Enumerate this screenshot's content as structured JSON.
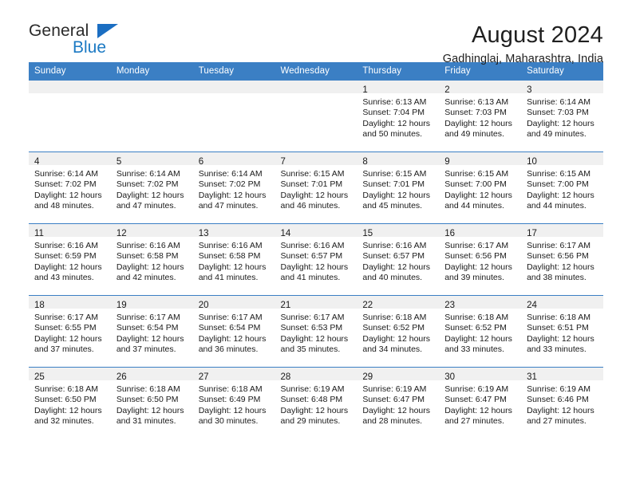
{
  "brand": {
    "name_top": "General",
    "name_bottom": "Blue",
    "flag_icon": "triangle-flag-icon",
    "accent_color": "#1b6ec2"
  },
  "header": {
    "title": "August 2024",
    "subtitle": "Gadhinglaj, Maharashtra, India"
  },
  "calendar": {
    "header_bg": "#3b7fc4",
    "daynum_bg": "#f0f0f0",
    "weekday_headers": [
      "Sunday",
      "Monday",
      "Tuesday",
      "Wednesday",
      "Thursday",
      "Friday",
      "Saturday"
    ],
    "weeks": [
      [
        {
          "day": "",
          "lines": []
        },
        {
          "day": "",
          "lines": []
        },
        {
          "day": "",
          "lines": []
        },
        {
          "day": "",
          "lines": []
        },
        {
          "day": "1",
          "lines": [
            "Sunrise: 6:13 AM",
            "Sunset: 7:04 PM",
            "Daylight: 12 hours",
            "and 50 minutes."
          ]
        },
        {
          "day": "2",
          "lines": [
            "Sunrise: 6:13 AM",
            "Sunset: 7:03 PM",
            "Daylight: 12 hours",
            "and 49 minutes."
          ]
        },
        {
          "day": "3",
          "lines": [
            "Sunrise: 6:14 AM",
            "Sunset: 7:03 PM",
            "Daylight: 12 hours",
            "and 49 minutes."
          ]
        }
      ],
      [
        {
          "day": "4",
          "lines": [
            "Sunrise: 6:14 AM",
            "Sunset: 7:02 PM",
            "Daylight: 12 hours",
            "and 48 minutes."
          ]
        },
        {
          "day": "5",
          "lines": [
            "Sunrise: 6:14 AM",
            "Sunset: 7:02 PM",
            "Daylight: 12 hours",
            "and 47 minutes."
          ]
        },
        {
          "day": "6",
          "lines": [
            "Sunrise: 6:14 AM",
            "Sunset: 7:02 PM",
            "Daylight: 12 hours",
            "and 47 minutes."
          ]
        },
        {
          "day": "7",
          "lines": [
            "Sunrise: 6:15 AM",
            "Sunset: 7:01 PM",
            "Daylight: 12 hours",
            "and 46 minutes."
          ]
        },
        {
          "day": "8",
          "lines": [
            "Sunrise: 6:15 AM",
            "Sunset: 7:01 PM",
            "Daylight: 12 hours",
            "and 45 minutes."
          ]
        },
        {
          "day": "9",
          "lines": [
            "Sunrise: 6:15 AM",
            "Sunset: 7:00 PM",
            "Daylight: 12 hours",
            "and 44 minutes."
          ]
        },
        {
          "day": "10",
          "lines": [
            "Sunrise: 6:15 AM",
            "Sunset: 7:00 PM",
            "Daylight: 12 hours",
            "and 44 minutes."
          ]
        }
      ],
      [
        {
          "day": "11",
          "lines": [
            "Sunrise: 6:16 AM",
            "Sunset: 6:59 PM",
            "Daylight: 12 hours",
            "and 43 minutes."
          ]
        },
        {
          "day": "12",
          "lines": [
            "Sunrise: 6:16 AM",
            "Sunset: 6:58 PM",
            "Daylight: 12 hours",
            "and 42 minutes."
          ]
        },
        {
          "day": "13",
          "lines": [
            "Sunrise: 6:16 AM",
            "Sunset: 6:58 PM",
            "Daylight: 12 hours",
            "and 41 minutes."
          ]
        },
        {
          "day": "14",
          "lines": [
            "Sunrise: 6:16 AM",
            "Sunset: 6:57 PM",
            "Daylight: 12 hours",
            "and 41 minutes."
          ]
        },
        {
          "day": "15",
          "lines": [
            "Sunrise: 6:16 AM",
            "Sunset: 6:57 PM",
            "Daylight: 12 hours",
            "and 40 minutes."
          ]
        },
        {
          "day": "16",
          "lines": [
            "Sunrise: 6:17 AM",
            "Sunset: 6:56 PM",
            "Daylight: 12 hours",
            "and 39 minutes."
          ]
        },
        {
          "day": "17",
          "lines": [
            "Sunrise: 6:17 AM",
            "Sunset: 6:56 PM",
            "Daylight: 12 hours",
            "and 38 minutes."
          ]
        }
      ],
      [
        {
          "day": "18",
          "lines": [
            "Sunrise: 6:17 AM",
            "Sunset: 6:55 PM",
            "Daylight: 12 hours",
            "and 37 minutes."
          ]
        },
        {
          "day": "19",
          "lines": [
            "Sunrise: 6:17 AM",
            "Sunset: 6:54 PM",
            "Daylight: 12 hours",
            "and 37 minutes."
          ]
        },
        {
          "day": "20",
          "lines": [
            "Sunrise: 6:17 AM",
            "Sunset: 6:54 PM",
            "Daylight: 12 hours",
            "and 36 minutes."
          ]
        },
        {
          "day": "21",
          "lines": [
            "Sunrise: 6:17 AM",
            "Sunset: 6:53 PM",
            "Daylight: 12 hours",
            "and 35 minutes."
          ]
        },
        {
          "day": "22",
          "lines": [
            "Sunrise: 6:18 AM",
            "Sunset: 6:52 PM",
            "Daylight: 12 hours",
            "and 34 minutes."
          ]
        },
        {
          "day": "23",
          "lines": [
            "Sunrise: 6:18 AM",
            "Sunset: 6:52 PM",
            "Daylight: 12 hours",
            "and 33 minutes."
          ]
        },
        {
          "day": "24",
          "lines": [
            "Sunrise: 6:18 AM",
            "Sunset: 6:51 PM",
            "Daylight: 12 hours",
            "and 33 minutes."
          ]
        }
      ],
      [
        {
          "day": "25",
          "lines": [
            "Sunrise: 6:18 AM",
            "Sunset: 6:50 PM",
            "Daylight: 12 hours",
            "and 32 minutes."
          ]
        },
        {
          "day": "26",
          "lines": [
            "Sunrise: 6:18 AM",
            "Sunset: 6:50 PM",
            "Daylight: 12 hours",
            "and 31 minutes."
          ]
        },
        {
          "day": "27",
          "lines": [
            "Sunrise: 6:18 AM",
            "Sunset: 6:49 PM",
            "Daylight: 12 hours",
            "and 30 minutes."
          ]
        },
        {
          "day": "28",
          "lines": [
            "Sunrise: 6:19 AM",
            "Sunset: 6:48 PM",
            "Daylight: 12 hours",
            "and 29 minutes."
          ]
        },
        {
          "day": "29",
          "lines": [
            "Sunrise: 6:19 AM",
            "Sunset: 6:47 PM",
            "Daylight: 12 hours",
            "and 28 minutes."
          ]
        },
        {
          "day": "30",
          "lines": [
            "Sunrise: 6:19 AM",
            "Sunset: 6:47 PM",
            "Daylight: 12 hours",
            "and 27 minutes."
          ]
        },
        {
          "day": "31",
          "lines": [
            "Sunrise: 6:19 AM",
            "Sunset: 6:46 PM",
            "Daylight: 12 hours",
            "and 27 minutes."
          ]
        }
      ]
    ]
  }
}
